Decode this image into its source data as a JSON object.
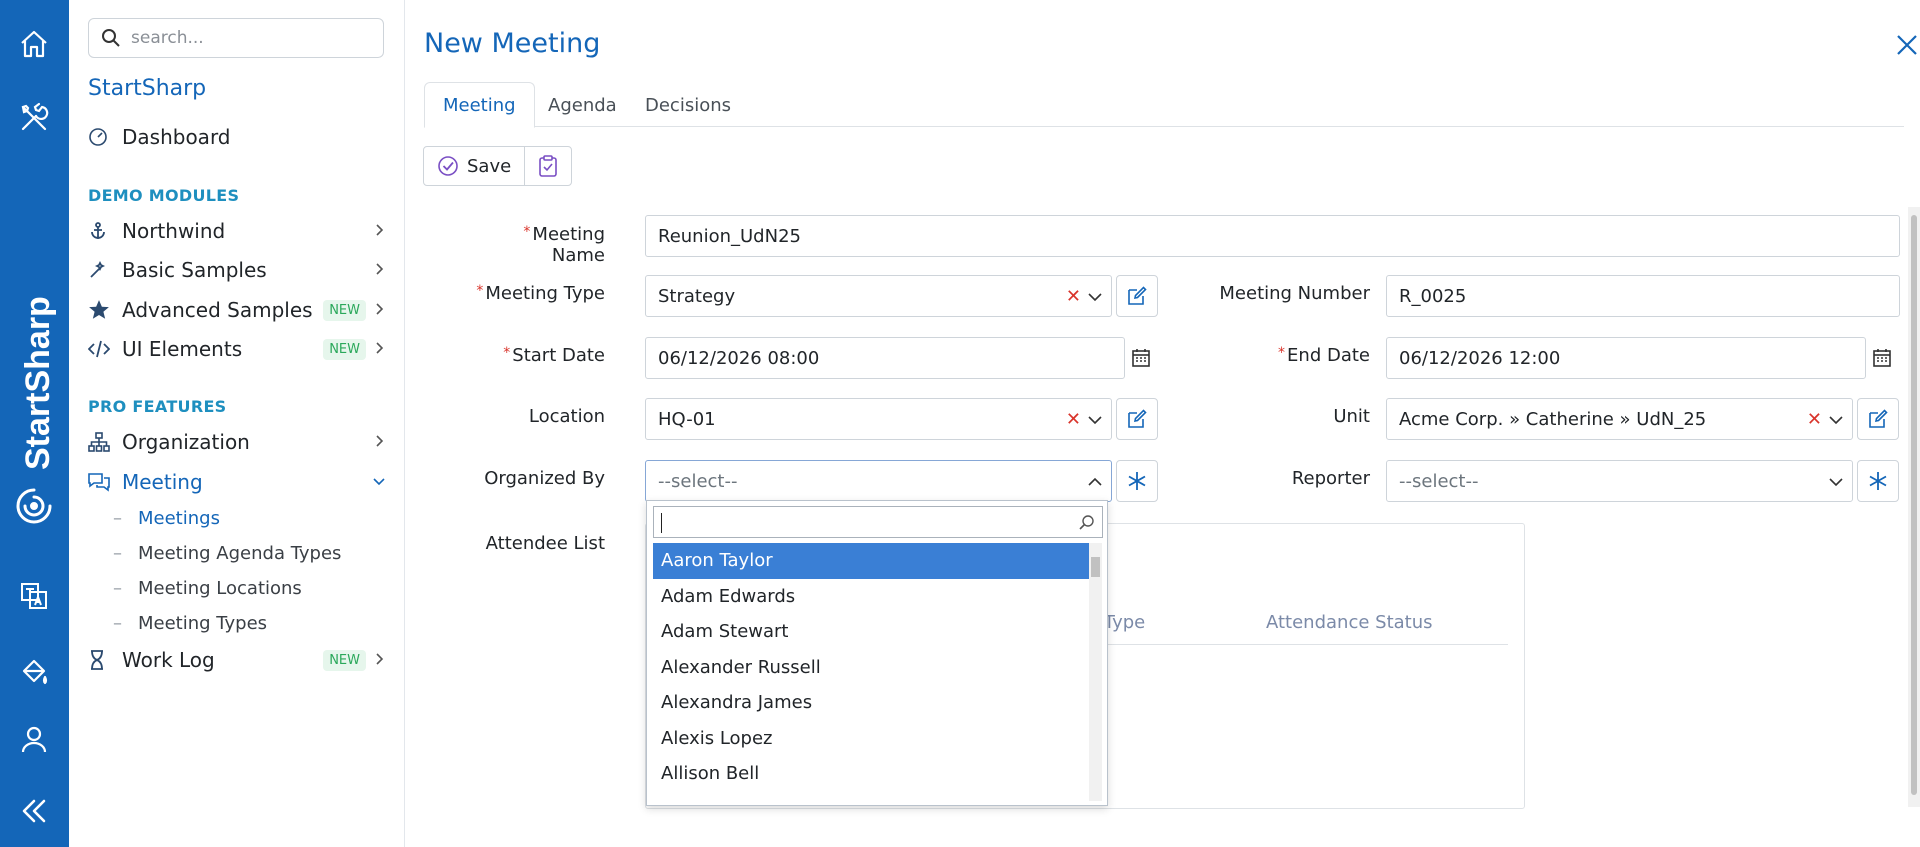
{
  "sidebar": {
    "search_placeholder": "search...",
    "app_name": "StartSharp",
    "dashboard": "Dashboard",
    "section_demo": "DEMO MODULES",
    "northwind": "Northwind",
    "basic_samples": "Basic Samples",
    "advanced_samples": "Advanced Samples",
    "ui_elements": "UI Elements",
    "section_pro": "PRO FEATURES",
    "organization": "Organization",
    "meeting": "Meeting",
    "meeting_subitems": [
      "Meetings",
      "Meeting Agenda Types",
      "Meeting Locations",
      "Meeting Types"
    ],
    "work_log": "Work Log",
    "new_badge": "NEW",
    "sub_dash": "–"
  },
  "rail": {
    "brand_text": "StartSharp",
    "icons": [
      "home-icon",
      "tools-icon",
      "translate-icon",
      "paint-bucket-icon",
      "user-icon",
      "collapse-icon"
    ]
  },
  "dialog": {
    "title": "New Meeting",
    "tabs": [
      "Meeting",
      "Agenda",
      "Decisions"
    ],
    "save_label": "Save",
    "fields": {
      "meeting_name_label": "Meeting Name",
      "meeting_name_value": "Reunion_UdN25",
      "meeting_type_label": "Meeting Type",
      "meeting_type_value": "Strategy",
      "meeting_number_label": "Meeting Number",
      "meeting_number_value": "R_0025",
      "start_date_label": "Start Date",
      "start_date_value": "06/12/2026 08:00",
      "end_date_label": "End Date",
      "end_date_value": "06/12/2026 12:00",
      "location_label": "Location",
      "location_value": "HQ-01",
      "unit_label": "Unit",
      "unit_value": "Acme Corp. » Catherine » UdN_25",
      "organized_by_label": "Organized By",
      "organized_by_placeholder": "--select--",
      "reporter_label": "Reporter",
      "reporter_placeholder": "--select--",
      "attendee_list_label": "Attendee List",
      "required_mark": "*"
    },
    "attendee_grid": {
      "columns": [
        "Attendee Type",
        "Attendance Status"
      ]
    },
    "dropdown": {
      "search_value": "",
      "options": [
        "Aaron Taylor",
        "Adam Edwards",
        "Adam Stewart",
        "Alexander Russell",
        "Alexandra James",
        "Alexis Lopez",
        "Allison Bell"
      ],
      "selected_index": 0
    }
  },
  "colors": {
    "brand": "#1466b8",
    "selected_option": "#3a7fd5",
    "required": "#d9342b",
    "new_badge": "#2aa85a"
  }
}
